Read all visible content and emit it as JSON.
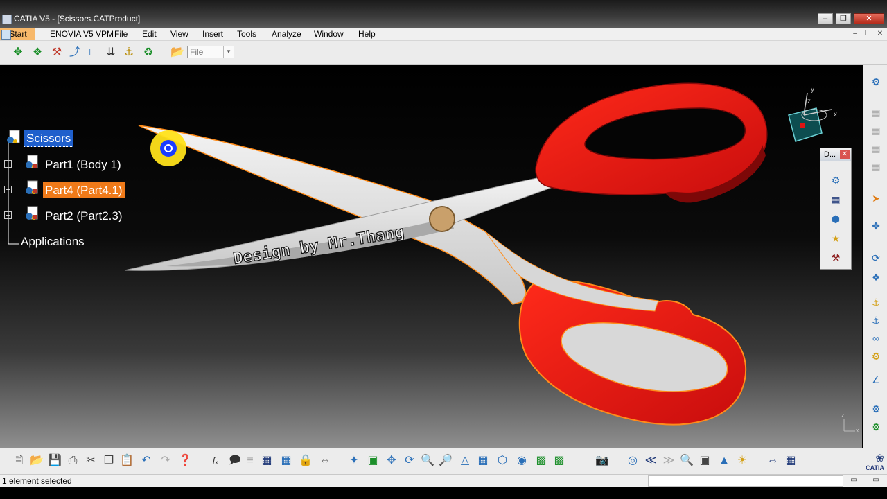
{
  "window": {
    "title": "CATIA V5 - [Scissors.CATProduct]"
  },
  "menu": {
    "items": [
      "Start",
      "ENOVIA V5 VPM",
      "File",
      "Edit",
      "View",
      "Insert",
      "Tools",
      "Analyze",
      "Window",
      "Help"
    ]
  },
  "toolbar_top": {
    "file_combo_value": "File"
  },
  "tree": {
    "root": "Scissors",
    "children": [
      "Part1 (Body 1)",
      "Part4 (Part4.1)",
      "Part2 (Part2.3)"
    ],
    "applications": "Applications"
  },
  "model": {
    "engraving": "Design by Mr.Thang"
  },
  "compass": {
    "x": "x",
    "y": "y",
    "z": "z"
  },
  "floating_palette": {
    "title": "D..."
  },
  "status": {
    "text": "1 element selected"
  },
  "brand": {
    "logo_text": "CATIA"
  },
  "colors": {
    "handle_red": "#e01414",
    "blade_silver": "#dcdcdc",
    "selection_orange": "#ef7a19",
    "selection_blue": "#1f5fcc"
  }
}
